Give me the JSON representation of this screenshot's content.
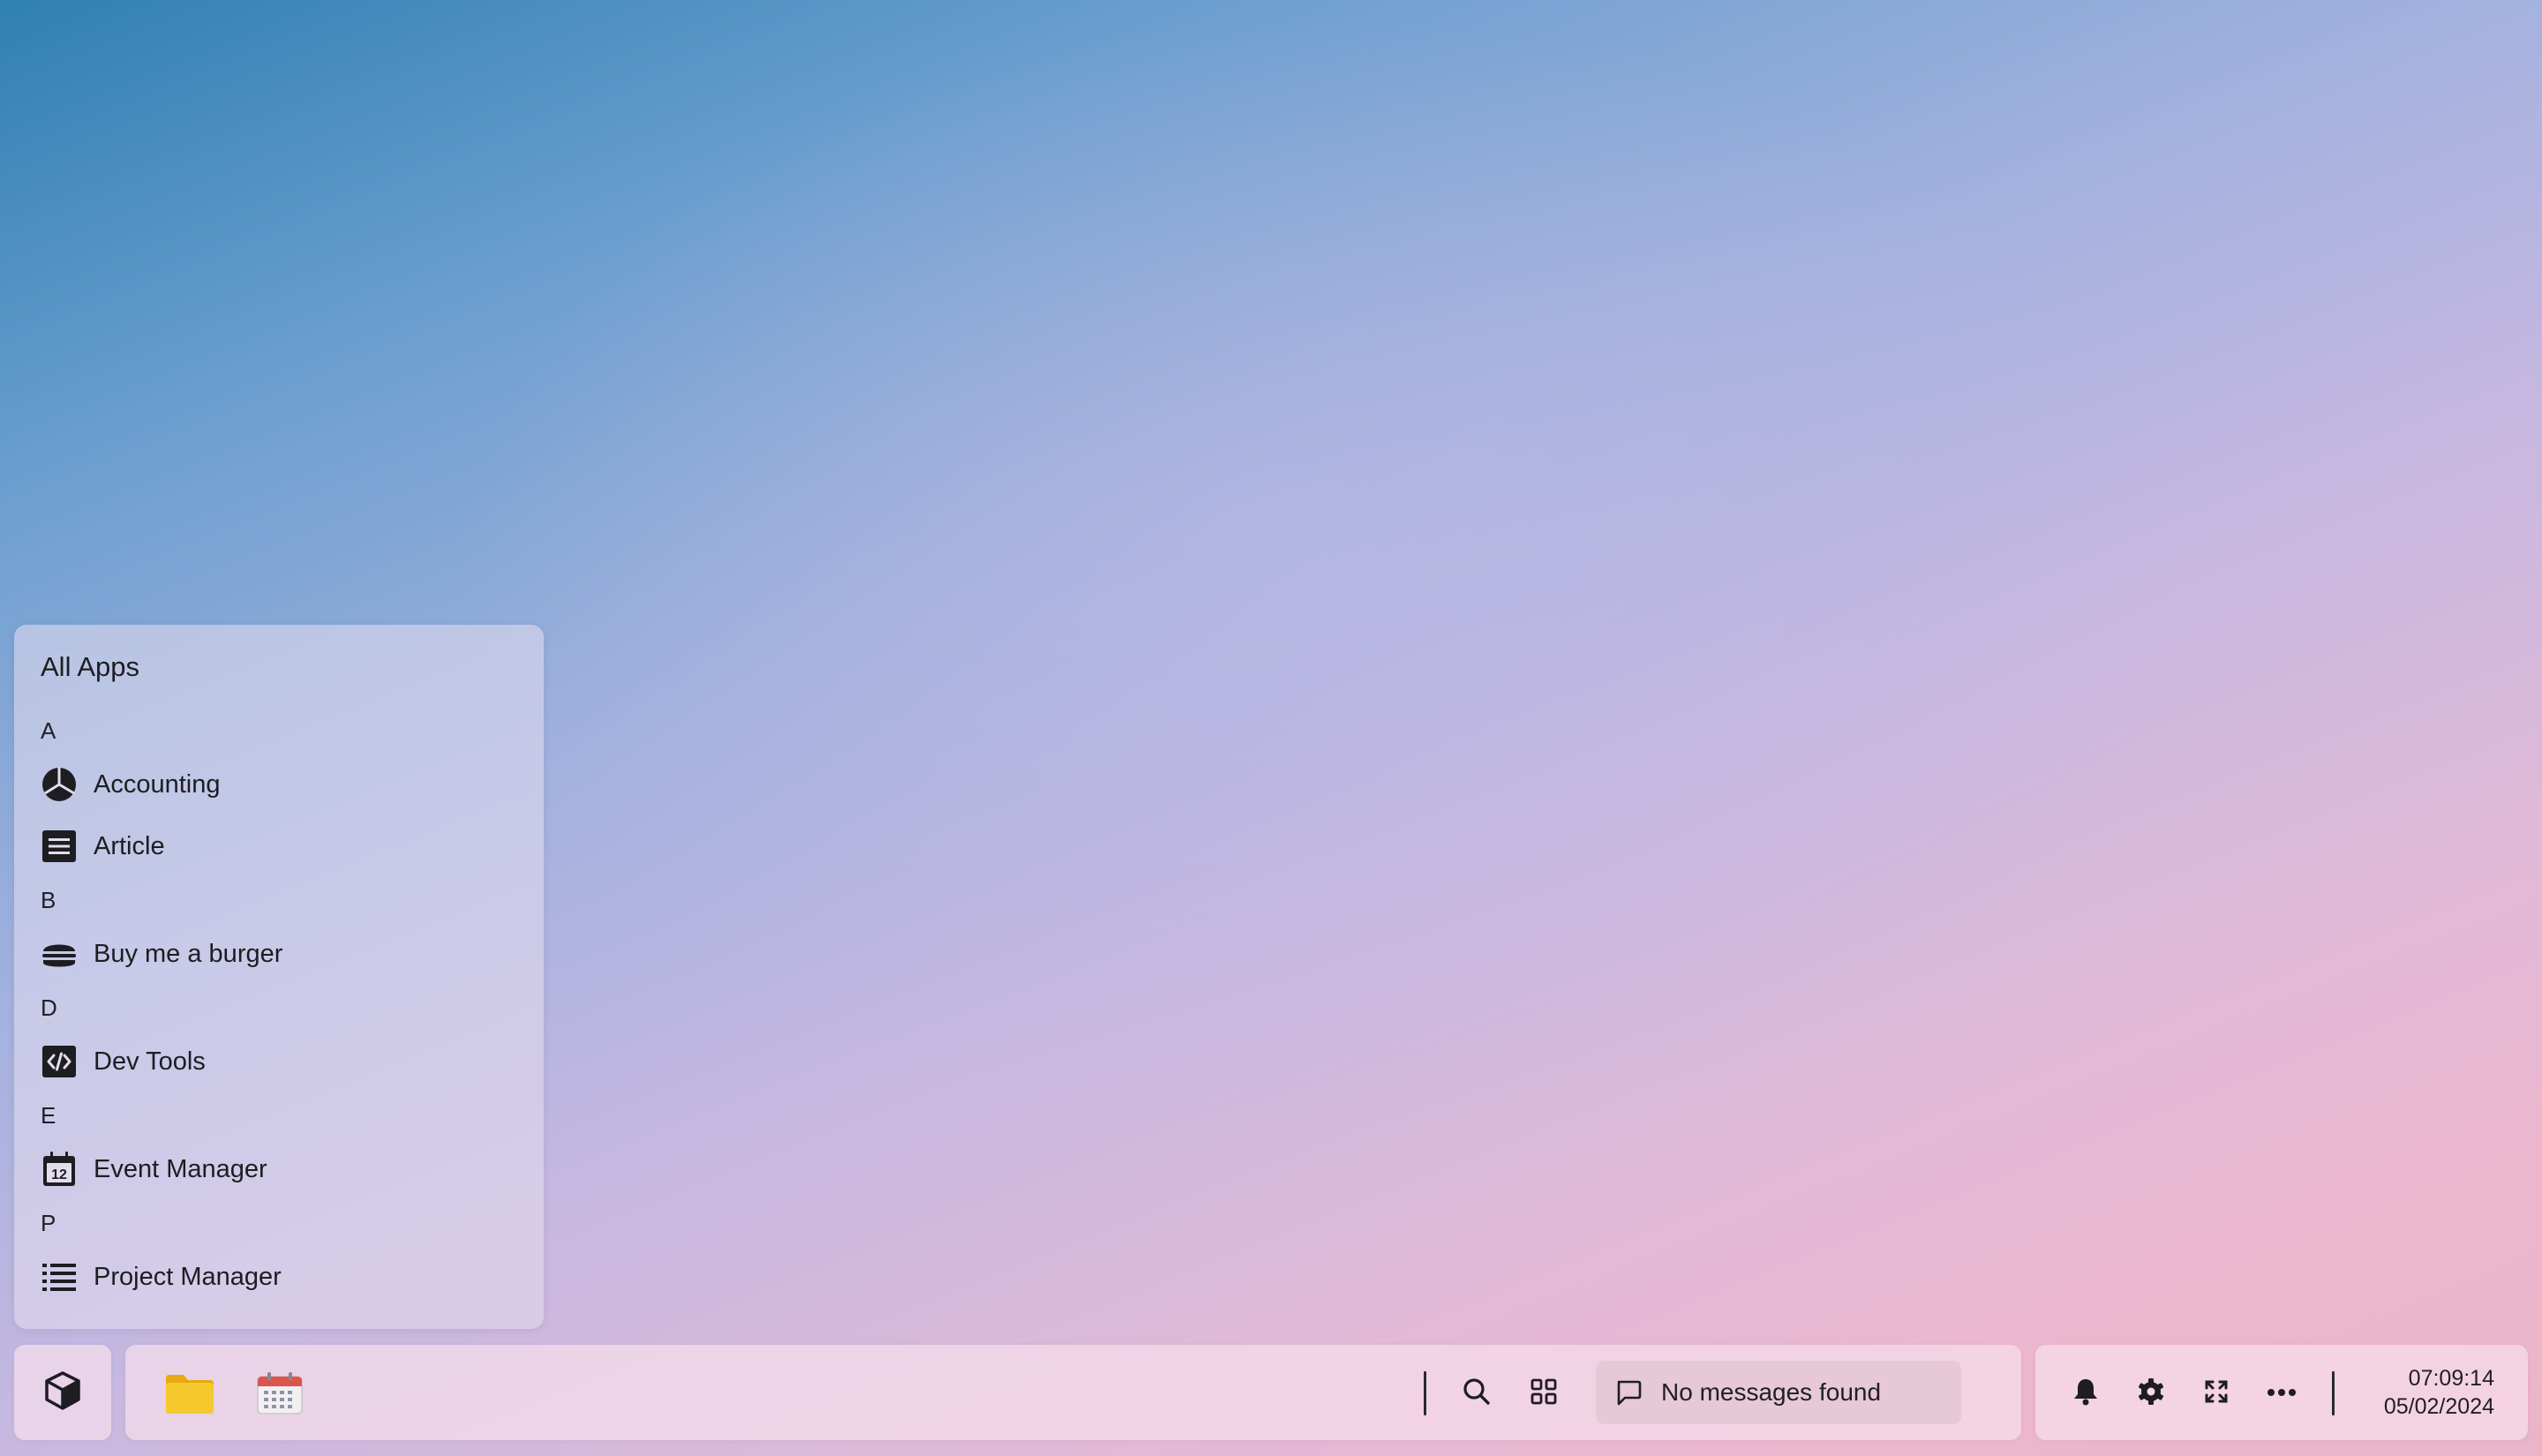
{
  "start_menu": {
    "title": "All Apps",
    "sections": [
      {
        "letter": "A",
        "apps": [
          {
            "label": "Accounting",
            "icon": "pie-chart-icon"
          },
          {
            "label": "Article",
            "icon": "article-icon"
          }
        ]
      },
      {
        "letter": "B",
        "apps": [
          {
            "label": "Buy me a burger",
            "icon": "burger-icon"
          }
        ]
      },
      {
        "letter": "D",
        "apps": [
          {
            "label": "Dev Tools",
            "icon": "code-icon"
          }
        ]
      },
      {
        "letter": "E",
        "apps": [
          {
            "label": "Event Manager",
            "icon": "calendar-12-icon"
          }
        ]
      },
      {
        "letter": "P",
        "apps": [
          {
            "label": "Project Manager",
            "icon": "list-icon"
          }
        ]
      }
    ]
  },
  "taskbar": {
    "start_icon": "cube-icon",
    "pinned": [
      {
        "name": "files",
        "icon": "folder-icon"
      },
      {
        "name": "calendar",
        "icon": "calendar-icon"
      }
    ],
    "search_icon": "search-icon",
    "apps_grid_icon": "grid-icon",
    "messages": {
      "icon": "chat-bubble-icon",
      "text": "No messages found"
    },
    "tray": {
      "icons": [
        "bell-icon",
        "gear-icon",
        "fullscreen-icon",
        "more-icon"
      ]
    },
    "clock": {
      "time": "07:09:14",
      "date": "05/02/2024"
    }
  },
  "colors": {
    "folder": "#f5c518",
    "calendar_header": "#e0534a",
    "icon_dark": "#1d1d22"
  }
}
